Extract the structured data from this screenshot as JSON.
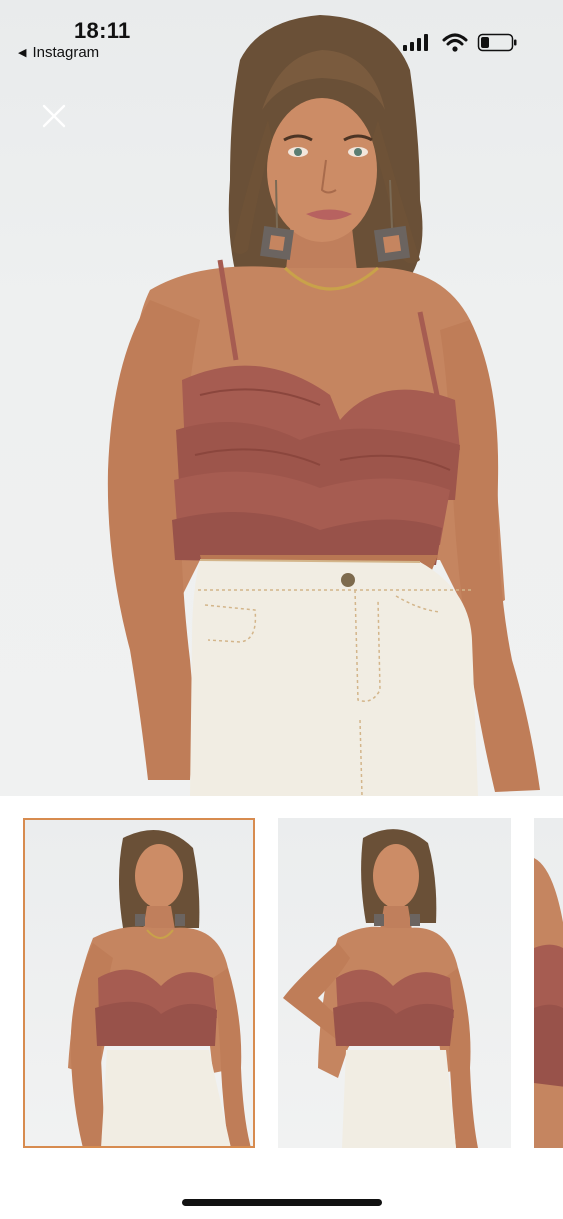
{
  "status_bar": {
    "time": "18:11",
    "back_app_label": "Instagram",
    "icons": [
      "signal-bars-icon",
      "wifi-icon",
      "battery-icon"
    ]
  },
  "viewer": {
    "close_icon": "close-icon",
    "hero_image": "product-photo-ruffle-crop-top-with-white-denim-skirt",
    "thumbnails": [
      {
        "image": "front-view-ruffle-crop-top",
        "selected": true
      },
      {
        "image": "side-pose-ruffle-crop-top",
        "selected": false
      },
      {
        "image": "detail-view-ruffle-crop-top",
        "selected": false
      }
    ]
  },
  "colors": {
    "selected_thumb_border": "#d78b4f",
    "top_fabric": "#a65c51",
    "skirt": "#f1ede3",
    "background": "#ffffff"
  }
}
